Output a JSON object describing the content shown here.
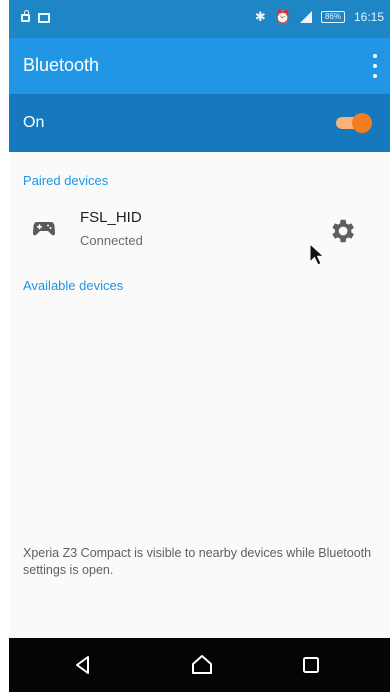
{
  "status_bar": {
    "time": "16:15",
    "battery": "86%",
    "icons": [
      "lock-icon",
      "image-icon",
      "bluetooth-icon",
      "alarm-icon",
      "signal-icon",
      "battery-icon"
    ]
  },
  "app_bar": {
    "title": "Bluetooth",
    "menu_icon": "more-vert-icon"
  },
  "toggle": {
    "label": "On",
    "state": "on",
    "accent_color": "#f57c1f"
  },
  "paired": {
    "header": "Paired devices",
    "devices": [
      {
        "name": "FSL_HID",
        "status": "Connected",
        "icon": "gamepad-icon",
        "action_icon": "gear-icon"
      }
    ]
  },
  "available": {
    "header": "Available devices"
  },
  "footer": {
    "note": "Xperia Z3 Compact is visible to nearby devices while Bluetooth settings is open."
  },
  "nav_bar": {
    "buttons": [
      "back-icon",
      "home-icon",
      "recents-icon"
    ]
  },
  "colors": {
    "status_bar": "#1f86c6",
    "app_bar": "#2196e4",
    "toggle_bar": "#1679bd",
    "section_header": "#2196e4"
  }
}
